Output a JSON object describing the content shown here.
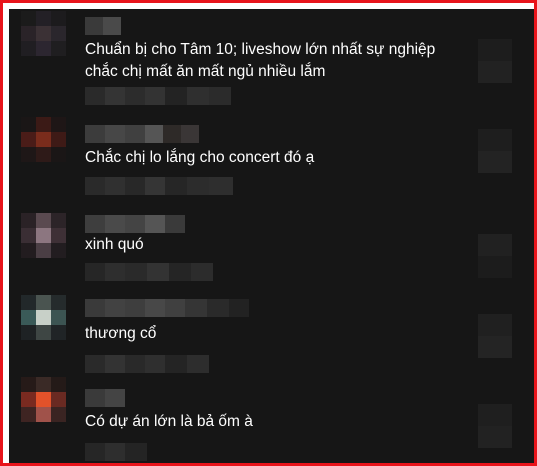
{
  "comments": [
    {
      "text_lines": [
        "Chuẩn bị cho Tâm 10; liveshow lớn nhất sự nghiệp",
        "chắc chị mất ăn mất ngủ nhiều lắm"
      ]
    },
    {
      "text_lines": [
        "Chắc chị lo lắng cho concert đó ạ"
      ]
    },
    {
      "text_lines": [
        "xinh quó"
      ]
    },
    {
      "text_lines": [
        "thương cổ"
      ]
    },
    {
      "text_lines": [
        "Có dự án lớn là bả ốm à"
      ]
    }
  ]
}
